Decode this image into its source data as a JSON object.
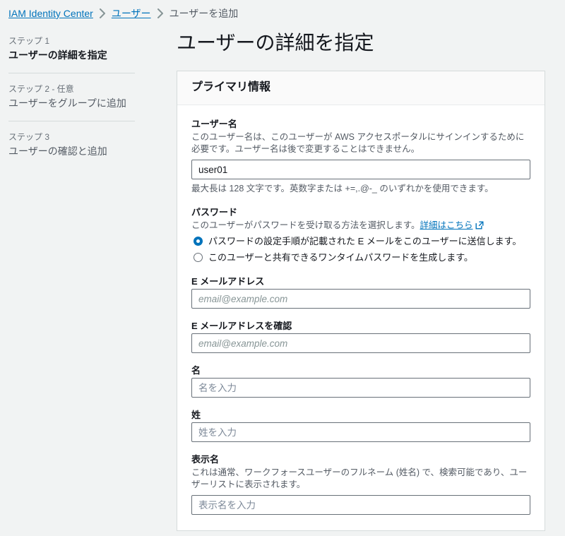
{
  "breadcrumb": {
    "items": [
      {
        "label": "IAM Identity Center",
        "type": "link"
      },
      {
        "label": "ユーザー",
        "type": "link"
      },
      {
        "label": "ユーザーを追加",
        "type": "current"
      }
    ]
  },
  "sidebar": {
    "steps": [
      {
        "number": "ステップ 1",
        "title": "ユーザーの詳細を指定",
        "active": true
      },
      {
        "number": "ステップ 2 - 任意",
        "title": "ユーザーをグループに追加",
        "active": false
      },
      {
        "number": "ステップ 3",
        "title": "ユーザーの確認と追加",
        "active": false
      }
    ]
  },
  "main": {
    "page_title": "ユーザーの詳細を指定",
    "panel": {
      "header_title": "プライマリ情報",
      "fields": {
        "username": {
          "label": "ユーザー名",
          "description": "このユーザー名は、このユーザーが AWS アクセスポータルにサインインするために必要です。ユーザー名は後で変更することはできません。",
          "value": "user01",
          "hint": "最大長は 128 文字です。英数字または +=,.@-_ のいずれかを使用できます。"
        },
        "password": {
          "label": "パスワード",
          "description": "このユーザーがパスワードを受け取る方法を選択します。",
          "link_label": "詳細はこちら",
          "options": [
            {
              "label": "パスワードの設定手順が記載された E メールをこのユーザーに送信します。",
              "selected": true
            },
            {
              "label": "このユーザーと共有できるワンタイムパスワードを生成します。",
              "selected": false
            }
          ]
        },
        "email": {
          "label": "E メールアドレス",
          "placeholder": "email@example.com",
          "value": ""
        },
        "email_confirm": {
          "label": "E メールアドレスを確認",
          "placeholder": "email@example.com",
          "value": ""
        },
        "first_name": {
          "label": "名",
          "placeholder": "名を入力",
          "value": ""
        },
        "last_name": {
          "label": "姓",
          "placeholder": "姓を入力",
          "value": ""
        },
        "display_name": {
          "label": "表示名",
          "description": "これは通常、ワークフォースユーザーのフルネーム (姓名) で、検索可能であり、ユーザーリストに表示されます。",
          "placeholder": "表示名を入力",
          "value": ""
        }
      }
    }
  },
  "colors": {
    "link": "#0073bb",
    "accent": "#0073bb",
    "page_bg": "#f1f3f3",
    "panel_bg": "#ffffff",
    "border": "#d5dbdb",
    "text": "#16191f",
    "muted_text": "#545b64"
  }
}
